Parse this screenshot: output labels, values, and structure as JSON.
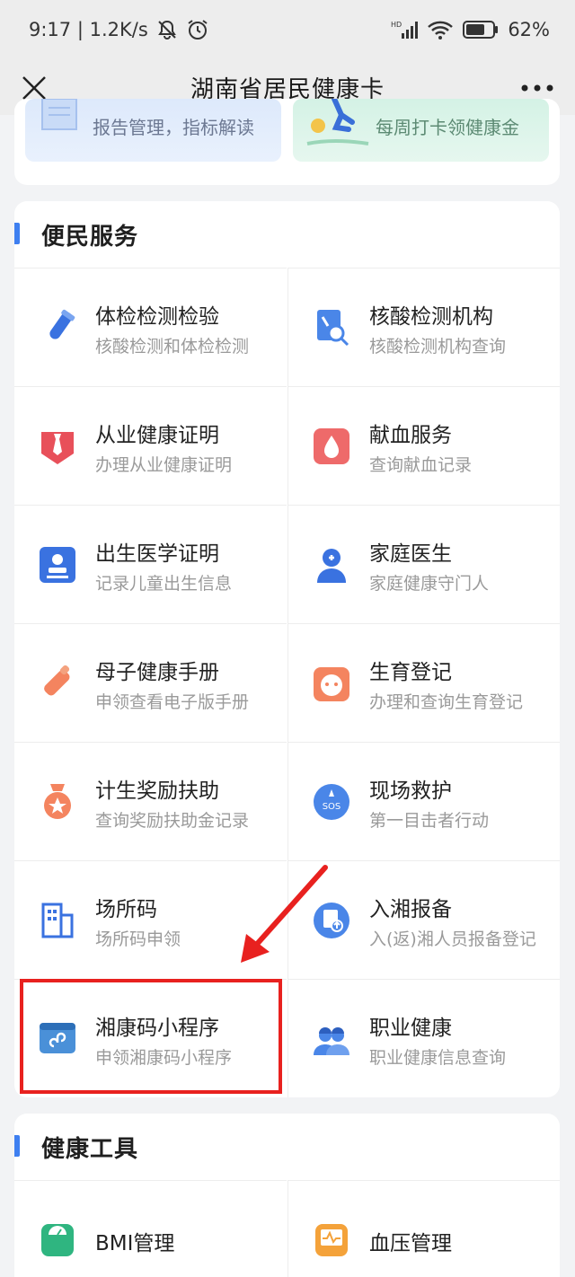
{
  "status_bar": {
    "time_speed": "9:17 | 1.2K/s",
    "battery": "62%"
  },
  "title_bar": {
    "title": "湖南省居民健康卡"
  },
  "top_banners": [
    {
      "text": "报告管理，指标解读"
    },
    {
      "text": "每周打卡领健康金"
    }
  ],
  "service_section": {
    "title": "便民服务",
    "items": [
      {
        "name": "体检检测检验",
        "desc": "核酸检测和体检检测",
        "icon": "test-tube-icon"
      },
      {
        "name": "核酸检测机构",
        "desc": "核酸检测机构查询",
        "icon": "document-search-icon"
      },
      {
        "name": "从业健康证明",
        "desc": "办理从业健康证明",
        "icon": "tie-certificate-icon"
      },
      {
        "name": "献血服务",
        "desc": "查询献血记录",
        "icon": "blood-drop-icon"
      },
      {
        "name": "出生医学证明",
        "desc": "记录儿童出生信息",
        "icon": "id-card-icon"
      },
      {
        "name": "家庭医生",
        "desc": "家庭健康守门人",
        "icon": "doctor-icon"
      },
      {
        "name": "母子健康手册",
        "desc": "申领查看电子版手册",
        "icon": "baby-bottle-icon"
      },
      {
        "name": "生育登记",
        "desc": "办理和查询生育登记",
        "icon": "baby-face-icon"
      },
      {
        "name": "计生奖励扶助",
        "desc": "查询奖励扶助金记录",
        "icon": "medal-icon"
      },
      {
        "name": "现场救护",
        "desc": "第一目击者行动",
        "icon": "sos-icon"
      },
      {
        "name": "场所码",
        "desc": "场所码申领",
        "icon": "building-icon"
      },
      {
        "name": "入湘报备",
        "desc": "入(返)湘人员报备登记",
        "icon": "report-upload-icon"
      },
      {
        "name": "湘康码小程序",
        "desc": "申领湘康码小程序",
        "icon": "mini-program-icon"
      },
      {
        "name": "职业健康",
        "desc": "职业健康信息查询",
        "icon": "workers-icon"
      }
    ]
  },
  "tool_section": {
    "title": "健康工具",
    "items": [
      {
        "name": "BMI管理",
        "icon": "scale-icon"
      },
      {
        "name": "血压管理",
        "icon": "blood-pressure-icon"
      }
    ]
  },
  "colors": {
    "accent": "#3e7ff0",
    "highlight_red": "#e8211f"
  }
}
